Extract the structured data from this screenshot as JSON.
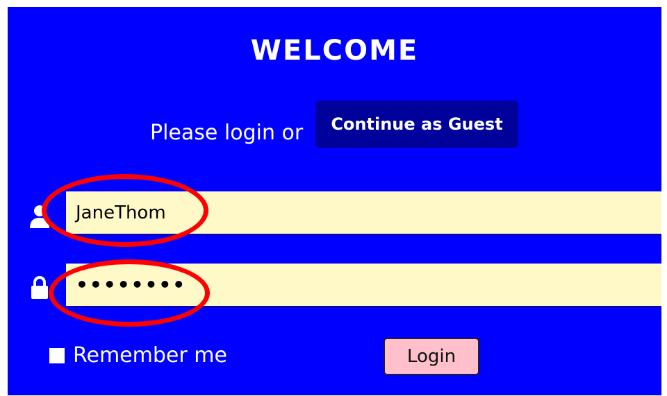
{
  "header": {
    "title": "WELCOME"
  },
  "intro": {
    "prompt": "Please login or",
    "guest_button": "Continue as Guest"
  },
  "form": {
    "username": {
      "value": "JaneThom",
      "icon": "user-icon"
    },
    "password": {
      "masked_value": "••••••••",
      "icon": "lock-icon"
    },
    "remember_label": "Remember me",
    "remember_checked": false,
    "login_button": "Login"
  },
  "colors": {
    "background": "#0000ff",
    "guest_button": "#00009a",
    "input_background": "#fff9c8",
    "login_button": "#ffc0cb",
    "annotation": "#ff0000"
  }
}
